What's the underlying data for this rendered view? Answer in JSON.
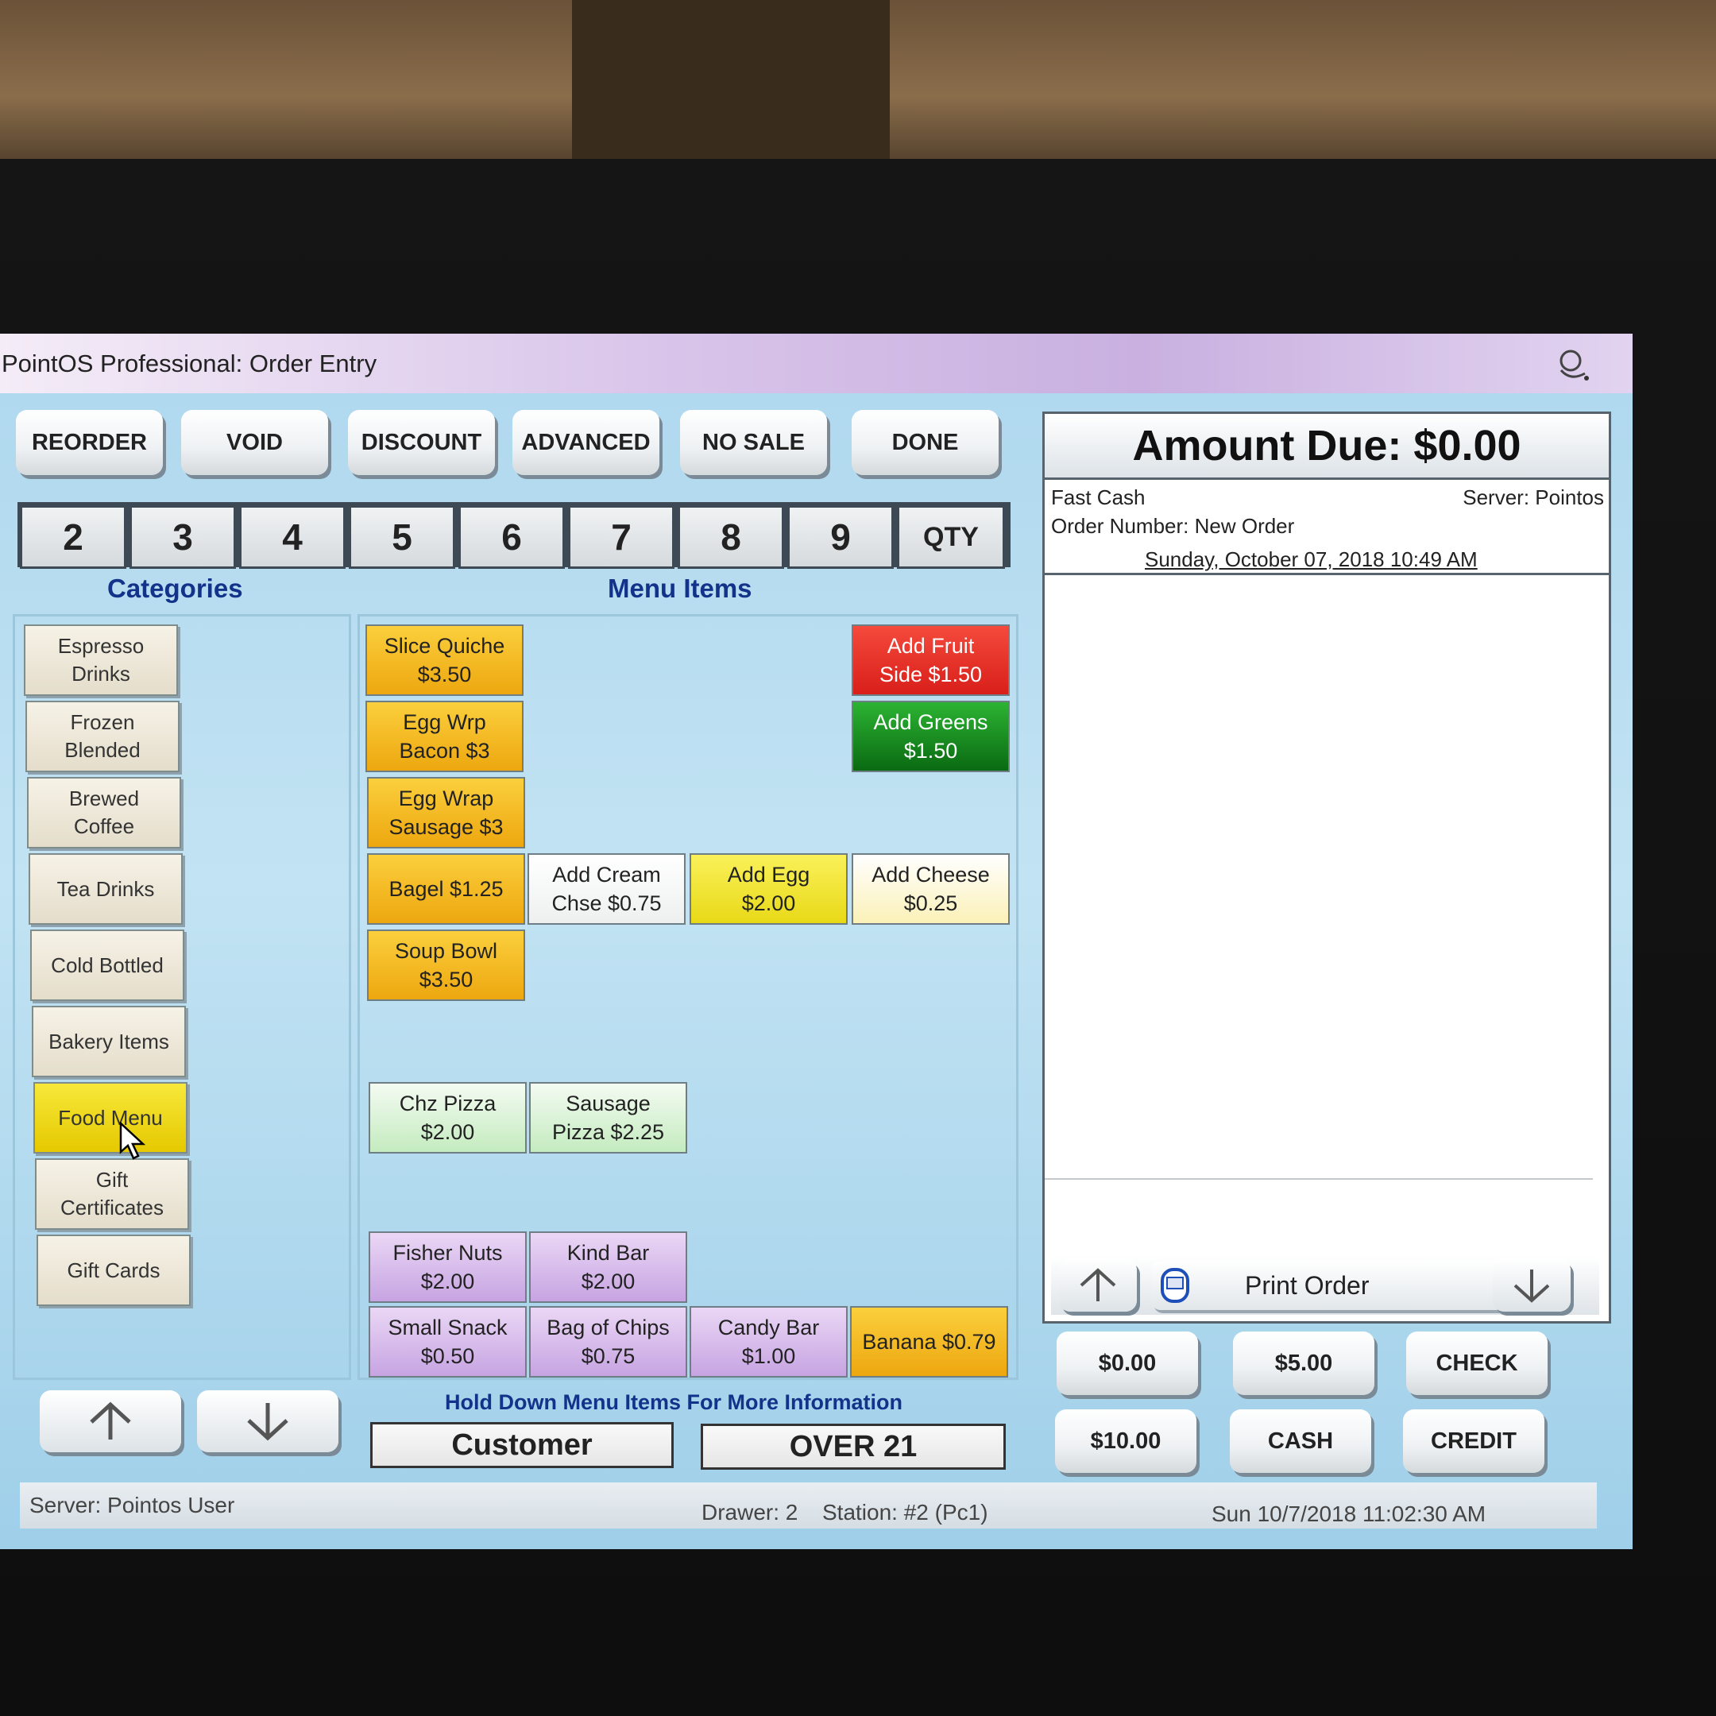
{
  "window": {
    "title": "PointOS Professional: Order Entry"
  },
  "toolbar": {
    "reorder": "REORDER",
    "void": "VOID",
    "discount": "DISCOUNT",
    "advanced": "ADVANCED",
    "no_sale": "NO SALE",
    "done": "DONE"
  },
  "numpad": [
    "2",
    "3",
    "4",
    "5",
    "6",
    "7",
    "8",
    "9",
    "QTY"
  ],
  "headers": {
    "categories": "Categories",
    "menu_items": "Menu Items"
  },
  "categories": [
    {
      "line1": "Espresso",
      "line2": "Drinks"
    },
    {
      "line1": "Frozen",
      "line2": "Blended"
    },
    {
      "line1": "Brewed",
      "line2": "Coffee"
    },
    {
      "line1": "Tea Drinks",
      "line2": ""
    },
    {
      "line1": "Cold Bottled",
      "line2": ""
    },
    {
      "line1": "Bakery Items",
      "line2": ""
    },
    {
      "line1": "Food Menu",
      "line2": ""
    },
    {
      "line1": "Gift",
      "line2": "Certificates"
    },
    {
      "line1": "Gift Cards",
      "line2": ""
    }
  ],
  "selected_category": "Food Menu",
  "menu_items": {
    "slice_quiche": {
      "line1": "Slice Quiche",
      "line2": "$3.50"
    },
    "egg_wrp_bacon": {
      "line1": "Egg Wrp",
      "line2": "Bacon $3"
    },
    "egg_wrap_sausage": {
      "line1": "Egg Wrap",
      "line2": "Sausage $3"
    },
    "bagel": {
      "line1": "Bagel $1.25",
      "line2": ""
    },
    "soup_bowl": {
      "line1": "Soup Bowl",
      "line2": "$3.50"
    },
    "add_fruit_side": {
      "line1": "Add Fruit",
      "line2": "Side $1.50"
    },
    "add_greens": {
      "line1": "Add Greens",
      "line2": "$1.50"
    },
    "add_cream_chse": {
      "line1": "Add Cream",
      "line2": "Chse $0.75"
    },
    "add_egg": {
      "line1": "Add Egg",
      "line2": "$2.00"
    },
    "add_cheese": {
      "line1": "Add Cheese",
      "line2": "$0.25"
    },
    "chz_pizza": {
      "line1": "Chz Pizza",
      "line2": "$2.00"
    },
    "sausage_pizza": {
      "line1": "Sausage",
      "line2": "Pizza $2.25"
    },
    "fisher_nuts": {
      "line1": "Fisher Nuts",
      "line2": "$2.00"
    },
    "kind_bar": {
      "line1": "Kind Bar",
      "line2": "$2.00"
    },
    "small_snack": {
      "line1": "Small Snack",
      "line2": "$0.50"
    },
    "bag_of_chips": {
      "line1": "Bag of Chips",
      "line2": "$0.75"
    },
    "candy_bar": {
      "line1": "Candy Bar",
      "line2": "$1.00"
    },
    "banana": {
      "line1": "Banana $0.79",
      "line2": ""
    }
  },
  "hint": "Hold Down Menu Items For More Information",
  "customer_label": "Customer",
  "over21_label": "OVER 21",
  "order": {
    "amount_due": "Amount Due: $0.00",
    "mode": "Fast Cash",
    "server": "Server: Pointos",
    "order_number": "Order Number: New Order",
    "datetime": "Sunday, October 07, 2018 10:49 AM",
    "print_order": "Print Order"
  },
  "payment": {
    "zero": "$0.00",
    "five": "$5.00",
    "check": "CHECK",
    "ten": "$10.00",
    "cash": "CASH",
    "credit": "CREDIT"
  },
  "status": {
    "server": "Server: Pointos User",
    "drawer": "Drawer: 2",
    "station": "Station: #2 (Pc1)",
    "clock": "Sun 10/7/2018 11:02:30 AM"
  },
  "icons": [
    "up-arrow-icon",
    "down-arrow-icon",
    "printer-icon",
    "app-logo-icon",
    "mouse-cursor-icon"
  ]
}
